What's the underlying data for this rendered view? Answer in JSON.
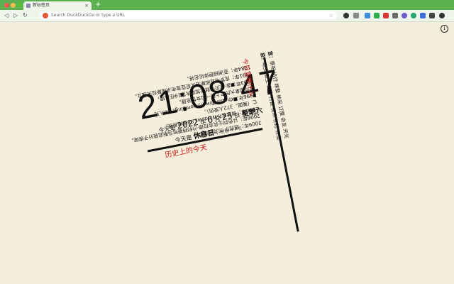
{
  "browser": {
    "tab_title": "新标签页",
    "tab_close": "×",
    "new_tab": "+",
    "back": "◁",
    "forward": "▷",
    "reload": "↻",
    "omnibox_placeholder": "Search DuckDuckGo or type a URL",
    "star": "☆",
    "info": "i"
  },
  "clock": {
    "time": "21:08:47",
    "today_prefix": "今天是",
    "year": "2022",
    "year_unit": "年",
    "month": "6",
    "month_unit": "月",
    "day": "25",
    "day_unit": "日",
    "weekday": "星期六",
    "status_prefix": "今天是",
    "status": "休息日",
    "status_suffix": "，放松一下吧"
  },
  "history": {
    "title": "历史上的今天",
    "items": [
      "1984年：亚洲短跑体坛名将。",
      "1991年：克罗地亚和斯洛文尼亚宣布从南斯拉夫独立。",
      "1993年：金·坎贝尔就任加拿大第19任总理，",
      "成为加拿大历史上第一位女性总理。",
      "1996年：Khobar Towers bombing，20人死",
      "亡（美国，372人受伤）。",
      "1998年：微软发布Windows 98操作系统。",
      "2006年：以色列士兵吉拉德·沙利特被哈马斯武装分子绑架。",
      "2009年：迈克尔·杰克逊逝世。"
    ]
  },
  "almanac": {
    "title": "今日宜做什么",
    "yi_label": "宜：",
    "yi_text": "祭祀 出行 嫁娶 纳采 订盟 会友 开光",
    "ji_label": "忌：",
    "ji_text": "动土 破土 安葬 行丧 伐木 作灶 修造"
  },
  "colors": {
    "accent": "#c91515",
    "frame": "#5db04f",
    "background": "#f5eedc"
  },
  "icons": [
    "close-icon",
    "plus-icon",
    "back-icon",
    "forward-icon",
    "reload-icon",
    "duckduckgo-icon",
    "star-icon",
    "extension-icon",
    "info-icon"
  ]
}
